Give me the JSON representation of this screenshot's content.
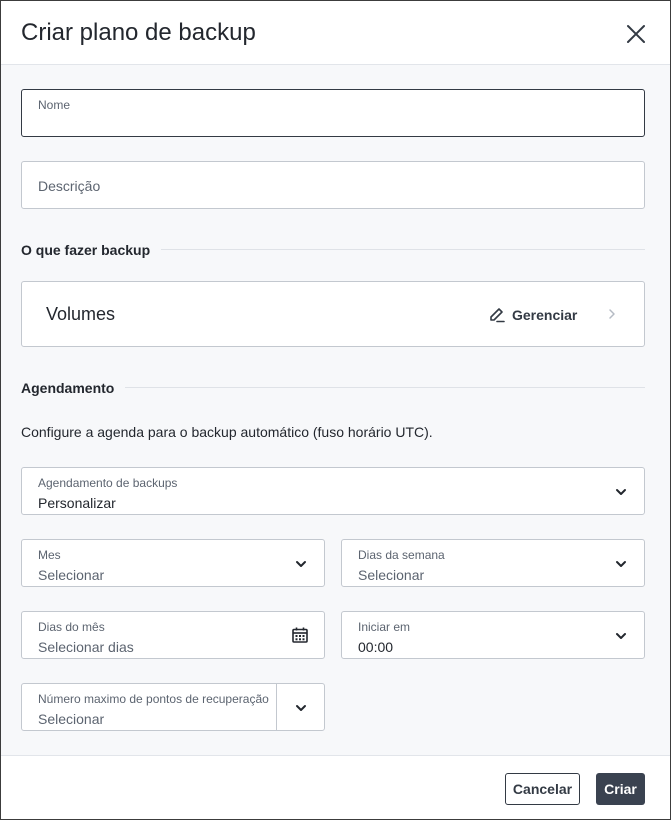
{
  "dialog": {
    "title": "Criar plano de backup",
    "close_icon": "close-icon"
  },
  "form": {
    "name": {
      "label": "Nome",
      "value": ""
    },
    "description": {
      "placeholder": "Descrição",
      "value": ""
    }
  },
  "what_to_backup": {
    "section_title": "O que fazer backup",
    "card_title": "Volumes",
    "manage_label": "Gerenciar",
    "manage_icon": "pencil-icon",
    "arrow_icon": "chevron-right-icon"
  },
  "schedule": {
    "section_title": "Agendamento",
    "info": "Configure a agenda para o backup automático (fuso horário UTC).",
    "backup_schedule": {
      "label": "Agendamento de backups",
      "value": "Personalizar"
    },
    "month": {
      "label": "Mes",
      "value": "Selecionar"
    },
    "weekdays": {
      "label": "Dias da semana",
      "value": "Selecionar"
    },
    "month_days": {
      "label": "Dias do mês",
      "value": "Selecionar dias",
      "icon": "calendar-icon"
    },
    "start_at": {
      "label": "Iniciar em",
      "value": "00:00"
    },
    "max_recovery_points": {
      "label": "Número maximo de pontos de recuperação",
      "value": "Selecionar"
    }
  },
  "footer": {
    "cancel_label": "Cancelar",
    "create_label": "Criar"
  },
  "colors": {
    "primary_button": "#3a4250",
    "border": "#c3c8cf",
    "text": "#23272e",
    "muted_text": "#5c6470"
  }
}
